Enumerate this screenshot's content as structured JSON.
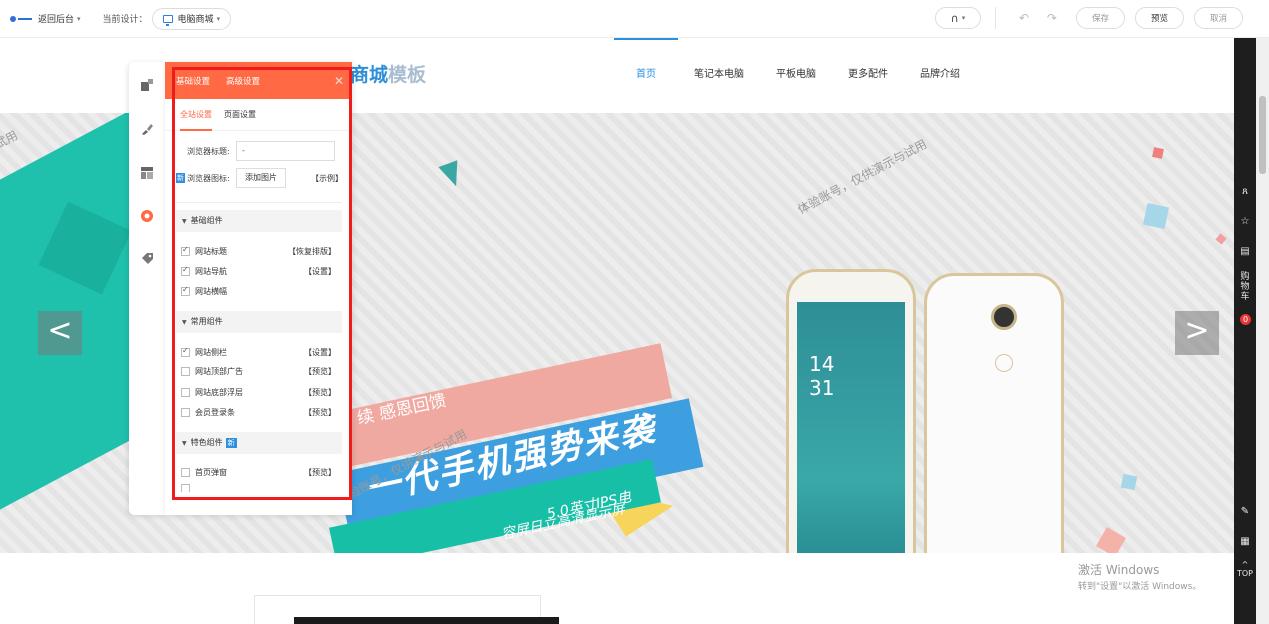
{
  "topbar": {
    "back_label": "返回后台",
    "current_design_label": "当前设计：",
    "site_select_value": "电脑商城",
    "save_label": "保存",
    "preview_label": "预览",
    "cancel_label": "取消"
  },
  "site": {
    "title_strong": "商城",
    "title_light": "模板",
    "nav": [
      "首页",
      "笔记本电脑",
      "平板电脑",
      "更多配件",
      "品牌介绍"
    ],
    "nav_active_index": 0
  },
  "banner": {
    "line1": "续 感恩回馈",
    "line2": "一代手机强势来袭",
    "line3": "5.0英寸IPS电",
    "line4": "容屏日立高清显示屏",
    "watermark": "体验账号，仅供演示与试用",
    "watermark_left_partial": "试用",
    "phone_time": "14\n31",
    "prev_arrow": "<",
    "next_arrow": ">"
  },
  "right_sidebar": {
    "cart_label": "购物车",
    "cart_count": "0",
    "top_label": "TOP"
  },
  "windows_activation": {
    "title": "激活 Windows",
    "subtitle": "转到\"设置\"以激活 Windows。"
  },
  "panel": {
    "tabs": [
      "基础设置",
      "高级设置"
    ],
    "subtabs": [
      "全站设置",
      "页面设置"
    ],
    "browser_title_label": "浏览器标题:",
    "browser_title_value": "-",
    "browser_icon_tag": "新",
    "browser_icon_label": "浏览器图标:",
    "add_image_button": "添加图片",
    "example_link": "【示例】",
    "groups": {
      "basic": "基础组件",
      "common": "常用组件",
      "special": "特色组件",
      "special_tag": "新"
    },
    "basic_items": [
      {
        "label": "网站标题",
        "action": "【恢复排版】",
        "checked": true
      },
      {
        "label": "网站导航",
        "action": "【设置】",
        "checked": true
      },
      {
        "label": "网站横幅",
        "action": "",
        "checked": true
      }
    ],
    "common_items": [
      {
        "label": "网站侧栏",
        "action": "【设置】",
        "checked": true
      },
      {
        "label": "网站顶部广告",
        "action": "【预览】",
        "checked": false
      },
      {
        "label": "网站底部浮层",
        "action": "【预览】",
        "checked": false
      },
      {
        "label": "会员登录条",
        "action": "【预览】",
        "checked": false
      }
    ],
    "special_items": [
      {
        "label": "首页弹窗",
        "action": "【预览】",
        "checked": false
      }
    ]
  },
  "colors": {
    "accent": "#ff6a45",
    "link_blue": "#2a8fe0",
    "highlight_frame": "#f01c1c"
  }
}
